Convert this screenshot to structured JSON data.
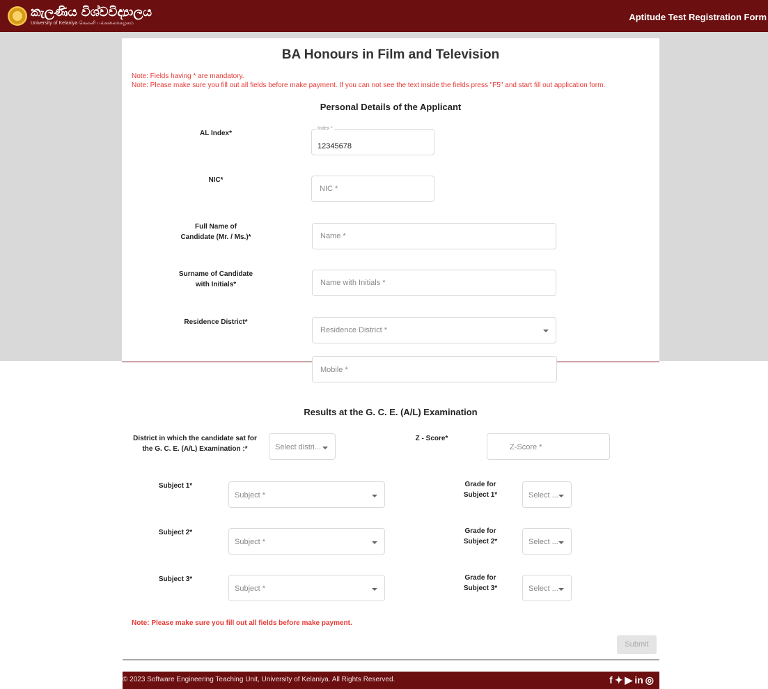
{
  "header": {
    "logo_sinhala": "කැලණිය විශ්වවිද්‍යාලය",
    "logo_english": "University of Kelaniya கெலனி பல்கலைக்கழகம்",
    "title": "Aptitude Test Registration Form"
  },
  "form": {
    "title": "BA Honours in Film and Television",
    "note1": "Note: Fields having * are mandatory.",
    "note2": "Note: Please make sure you fill out all fields before make payment. If you can not see the text inside the fields press \"F5\" and start fill out application form.",
    "personal_section": "Personal Details of the Applicant",
    "al_index": {
      "label": "AL Index*",
      "floating_label": "Index *",
      "value": "12345678"
    },
    "nic": {
      "label": "NIC*",
      "placeholder": "NIC *"
    },
    "full_name": {
      "label_line1": "Full Name of",
      "label_line2": "Candidate (Mr. / Ms.)*",
      "placeholder": "Name *"
    },
    "surname": {
      "label_line1": "Surname of Candidate",
      "label_line2": "with Initials*",
      "placeholder": "Name with Initials *"
    },
    "district": {
      "label": "Residence District*",
      "placeholder": "Residence District *"
    },
    "mobile": {
      "placeholder": "Mobile *"
    },
    "results_section": "Results at the G. C. E. (A/L) Examination",
    "exam_district": {
      "label_line1": "District in which the candidate sat for",
      "label_line2": "the G. C. E. (A/L) Examination :*",
      "placeholder": "Select distri..."
    },
    "zscore": {
      "label": "Z - Score*",
      "placeholder": "Z-Score *"
    },
    "subjects": [
      {
        "label": "Subject 1*",
        "placeholder": "Subject *",
        "grade_label_line1": "Grade for",
        "grade_label_line2": "Subject 1*",
        "grade_placeholder": "Select ..."
      },
      {
        "label": "Subject 2*",
        "placeholder": "Subject *",
        "grade_label_line1": "Grade for",
        "grade_label_line2": "Subject 2*",
        "grade_placeholder": "Select ..."
      },
      {
        "label": "Subject 3*",
        "placeholder": "Subject *",
        "grade_label_line1": "Grade for",
        "grade_label_line2": "Subject 3*",
        "grade_placeholder": "Select ..."
      }
    ],
    "bottom_note": "Note: Please make sure you fill out all fields before make payment.",
    "submit_label": "Submit"
  },
  "footer": {
    "copyright": "© 2023 Software Engineering Teaching Unit, University of Kelaniya. All Rights Reserved.",
    "social": [
      "facebook-icon",
      "twitter-icon",
      "youtube-icon",
      "linkedin-icon",
      "instagram-icon"
    ]
  },
  "colors": {
    "brand": "#6b0f10",
    "note": "#e53935",
    "panel_background": "#d9d9d9"
  }
}
